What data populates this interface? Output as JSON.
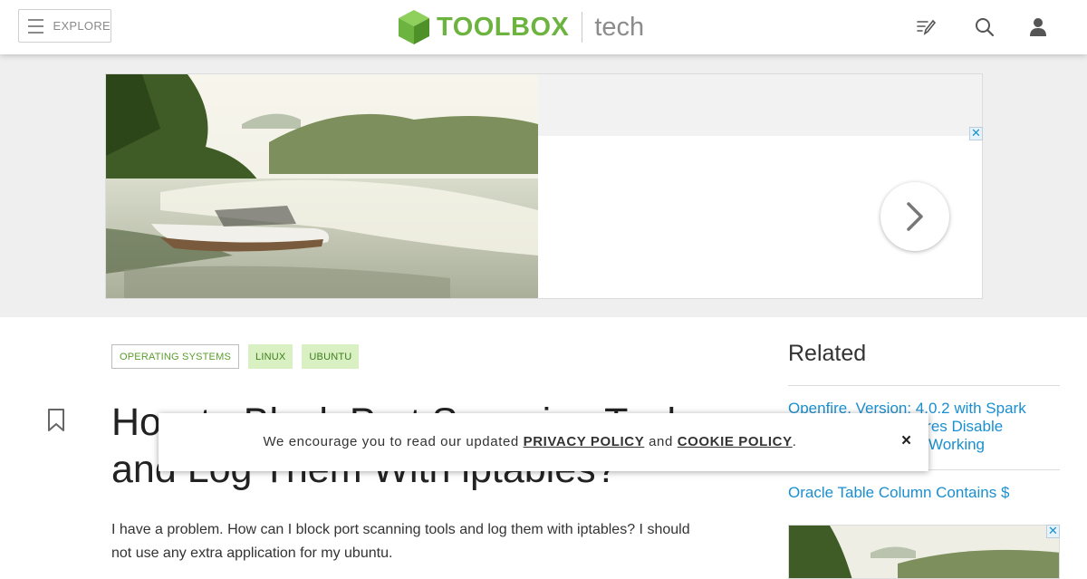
{
  "header": {
    "explore_label": "EXPLORE",
    "logo_primary": "TOOLBOX",
    "logo_secondary": "tech",
    "icons": [
      "write-icon",
      "search-icon",
      "user-icon"
    ],
    "brand_color": "#6cb33f"
  },
  "ad": {
    "close_glyph": "✕",
    "next_icon": "chevron-right-icon"
  },
  "tags": [
    {
      "label": "OPERATING SYSTEMS",
      "style": "outline"
    },
    {
      "label": "LINUX",
      "style": "filled"
    },
    {
      "label": "UBUNTU",
      "style": "filled"
    }
  ],
  "article": {
    "title": "How to Block Port Scanning Tools and Log Them With iptables?",
    "body": "I have a problem. How can I block port scanning tools and log them with iptables? I should not use any extra application for my ubuntu."
  },
  "sidebar": {
    "heading": "Related",
    "links": [
      "Openfire, Version: 4.0.2 with Spark Version: 2.7.7 Features Disable Screen Capture Not Working",
      "Oracle Table Column Contains $"
    ],
    "ad_close_glyph": "✕"
  },
  "notice": {
    "text_before": "We encourage you to read our updated",
    "privacy_link": "PRIVACY POLICY",
    "text_and": "and",
    "cookie_link": "COOKIE POLICY",
    "text_after": ".",
    "close_glyph": "×"
  },
  "colors": {
    "link": "#1a8fd0",
    "tag_fill": "#d9f0c3"
  }
}
